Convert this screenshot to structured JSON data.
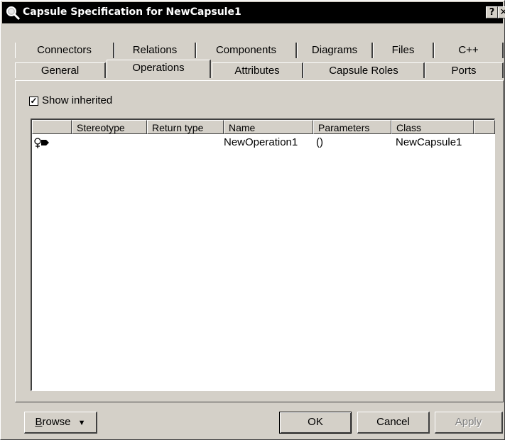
{
  "window": {
    "title": "Capsule Specification for NewCapsule1",
    "help_label": "?",
    "close_label": "✕"
  },
  "tabs": {
    "back_row": [
      {
        "label": "Connectors"
      },
      {
        "label": "Relations"
      },
      {
        "label": "Components"
      },
      {
        "label": "Diagrams"
      },
      {
        "label": "Files"
      },
      {
        "label": "C++"
      }
    ],
    "front_row": [
      {
        "label": "General"
      },
      {
        "label": "Operations"
      },
      {
        "label": "Attributes"
      },
      {
        "label": "Capsule Roles"
      },
      {
        "label": "Ports"
      }
    ],
    "active": "Operations"
  },
  "show_inherited": {
    "label": "Show inherited",
    "checked": true,
    "check_glyph": "✓"
  },
  "list": {
    "columns": [
      "",
      "Stereotype",
      "Return type",
      "Name",
      "Parameters",
      "Class"
    ],
    "rows": [
      {
        "icon": "operation-icon",
        "stereotype": "",
        "return_type": "",
        "name": "NewOperation1",
        "parameters": "()",
        "class": "NewCapsule1"
      }
    ]
  },
  "buttons": {
    "browse": {
      "underline_char": "B",
      "rest": "rowse",
      "arrow": "▼"
    },
    "ok": "OK",
    "cancel": "Cancel",
    "apply": "Apply"
  },
  "icons": {
    "title_icon": "magnifier-icon"
  }
}
